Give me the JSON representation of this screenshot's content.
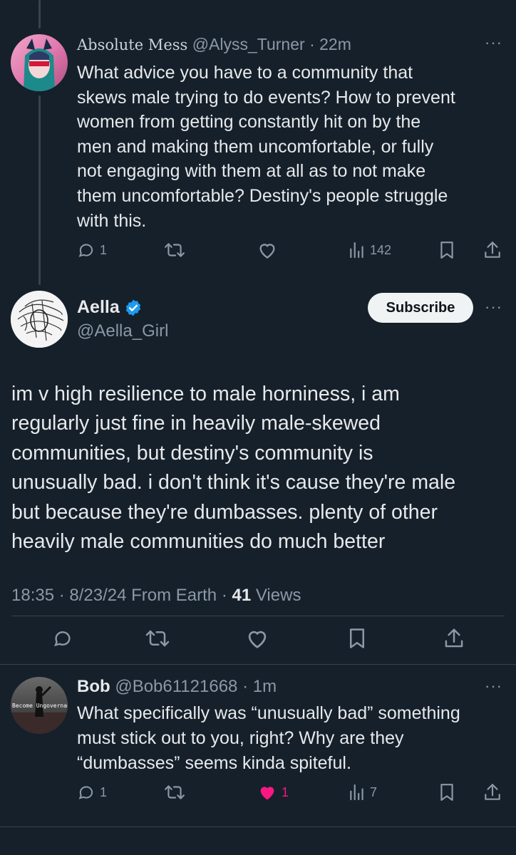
{
  "reply_parent": {
    "display_name": "Absolute Mess",
    "handle": "@Alyss_Turner",
    "time": "· 22m",
    "lines": [
      "What advice you have to a community that",
      "skews male trying to do events? How to prevent",
      "women from getting constantly hit on by the",
      "men and making them uncomfortable, or fully",
      "not engaging with them at all as to not make",
      "them uncomfortable? Destiny's people struggle",
      "with this."
    ],
    "replies": "1",
    "views": "142"
  },
  "main_tweet": {
    "display_name": "Aella",
    "handle": "@Aella_Girl",
    "subscribe_label": "Subscribe",
    "lines": [
      "im v high resilience to male horniness, i am",
      "regularly just fine in heavily male-skewed",
      "communities, but destiny's community is",
      "unusually bad. i don't think it's cause they're male",
      "but because they're dumbasses. plenty of other",
      "heavily male communities do much better"
    ],
    "meta_time": "18:35 · 8/23/24 From Earth ·",
    "views_count": "41",
    "views_label": "Views"
  },
  "reply": {
    "display_name": "Bob",
    "handle": "@Bob61121668",
    "time": "· 1m",
    "avatar_text": "Become Ungovernable",
    "lines": [
      "What specifically was “unusually bad” something",
      "must stick out to you, right? Why are they",
      "“dumbasses” seems kinda spiteful."
    ],
    "replies": "1",
    "likes": "1",
    "views": "7"
  },
  "colors": {
    "background": "#15202b",
    "text": "#e7e9ea",
    "muted": "#8b98a5",
    "verified": "#1d9bf0",
    "like_active": "#f91880"
  },
  "icons": [
    "reply-icon",
    "retweet-icon",
    "like-icon",
    "views-icon",
    "bookmark-icon",
    "share-icon",
    "more-icon",
    "verified-badge-icon"
  ]
}
